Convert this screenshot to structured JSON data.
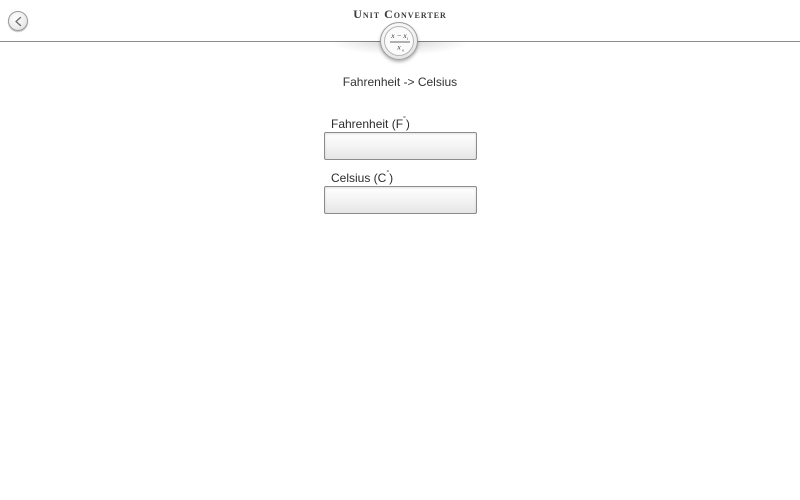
{
  "header": {
    "title": "Unit Converter",
    "back_icon": "chevron-left-icon",
    "logo_icon": "formula-badge-icon",
    "logo_formula": {
      "numerator": "x − x",
      "numerator_sub": "i",
      "denominator": "x",
      "denominator_sub": "o"
    }
  },
  "main": {
    "conversion_title": "Fahrenheit -> Celsius",
    "fields": [
      {
        "label": "Fahrenheit (F",
        "unit_mark": "°",
        "label_close": ")",
        "value": "",
        "placeholder": ""
      },
      {
        "label": "Celsius (C",
        "unit_mark": "°",
        "label_close": ")",
        "value": "",
        "placeholder": ""
      }
    ]
  },
  "colors": {
    "header_border": "#8e8e8e",
    "text": "#333333",
    "input_border": "#8c8c8c"
  }
}
